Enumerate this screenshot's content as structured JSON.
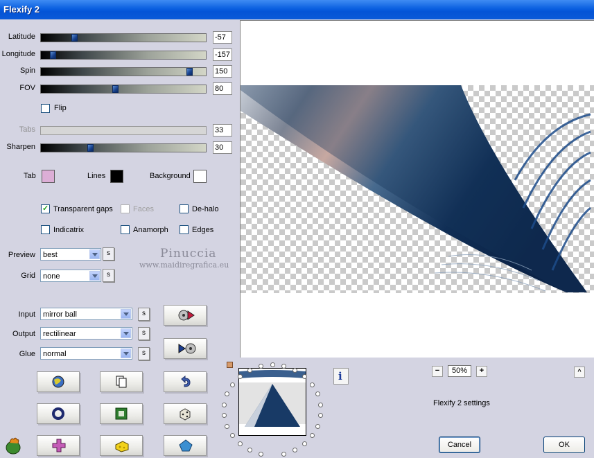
{
  "window": {
    "title": "Flexify 2"
  },
  "sliders": [
    {
      "label": "Latitude",
      "value": "-57",
      "pos": 0.2,
      "enabled": true
    },
    {
      "label": "Longitude",
      "value": "-157",
      "pos": 0.07,
      "enabled": true
    },
    {
      "label": "Spin",
      "value": "150",
      "pos": 0.9,
      "enabled": true
    },
    {
      "label": "FOV",
      "value": "80",
      "pos": 0.45,
      "enabled": true
    },
    {
      "label": "Tabs",
      "value": "33",
      "pos": 0.0,
      "enabled": false
    },
    {
      "label": "Sharpen",
      "value": "30",
      "pos": 0.3,
      "enabled": true
    }
  ],
  "flip": {
    "label": "Flip",
    "checked": false
  },
  "colors": {
    "tab": {
      "label": "Tab",
      "color": "#dcaed6"
    },
    "lines": {
      "label": "Lines",
      "color": "#000000"
    },
    "background": {
      "label": "Background",
      "color": "#ffffff"
    }
  },
  "checkboxes": {
    "transparent_gaps": {
      "label": "Transparent gaps",
      "checked": true
    },
    "faces": {
      "label": "Faces",
      "checked": false,
      "enabled": false
    },
    "de_halo": {
      "label": "De-halo",
      "checked": false
    },
    "indicatrix": {
      "label": "Indicatrix",
      "checked": false
    },
    "anamorph": {
      "label": "Anamorph",
      "checked": false
    },
    "edges": {
      "label": "Edges",
      "checked": false
    }
  },
  "preview_select": {
    "label": "Preview",
    "value": "best"
  },
  "grid_select": {
    "label": "Grid",
    "value": "none"
  },
  "input_select": {
    "label": "Input",
    "value": "mirror ball"
  },
  "output_select": {
    "label": "Output",
    "value": "rectilinear"
  },
  "glue_select": {
    "label": "Glue",
    "value": "normal"
  },
  "s_button_label": "s",
  "watermark": {
    "line1": "Pinuccia",
    "line2": "www.maidiregrafica.eu"
  },
  "zoom": {
    "minus": "−",
    "value": "50%",
    "plus": "+"
  },
  "collapse_label": "^",
  "settings_text": "Flexify 2 settings",
  "info_label": "i",
  "buttons": {
    "cancel": "Cancel",
    "ok": "OK"
  },
  "icons": {
    "input_to_output": "disc-arrow-right-icon",
    "output_to_input": "arrow-disc-icon",
    "randomize": "globe-icon",
    "copy": "copy-pages-icon",
    "undo": "undo-arrow-icon",
    "ring": "ring-icon",
    "square": "green-square-icon",
    "dice": "dice-icon",
    "cross": "cross-icon",
    "cheese": "cheese-block-icon",
    "pentagon": "pentagon-icon",
    "logo": "flaming-pear-logo-icon"
  }
}
